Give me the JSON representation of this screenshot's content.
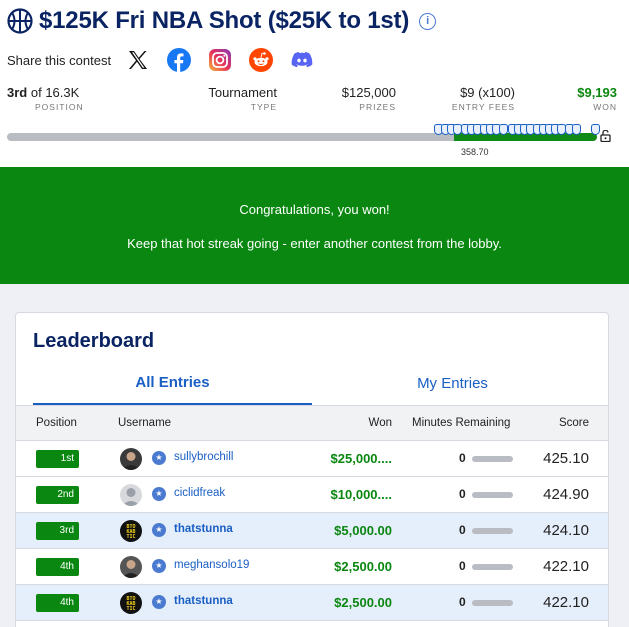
{
  "contest": {
    "title": "$125K Fri NBA Shot ($25K to 1st)",
    "share_label": "Share this contest",
    "socials": [
      "x-icon",
      "facebook-icon",
      "instagram-icon",
      "reddit-icon",
      "discord-icon"
    ]
  },
  "stats": {
    "rank_place": "3rd",
    "rank_of": "of 16.3K",
    "position_label": "POSITION",
    "type_value": "Tournament",
    "type_label": "TYPE",
    "prizes_value": "$125,000",
    "prizes_label": "PRIZES",
    "fees_value": "$9 (x100)",
    "fees_label": "ENTRY FEES",
    "won_value": "$9,193",
    "won_label": "WON"
  },
  "progress": {
    "value_label": "358.70"
  },
  "banner": {
    "line1": "Congratulations, you won!",
    "line2": "Keep that hot streak going - enter another contest from the lobby."
  },
  "leaderboard": {
    "title": "Leaderboard",
    "tabs": [
      "All Entries",
      "My Entries"
    ],
    "columns": {
      "position": "Position",
      "username": "Username",
      "won": "Won",
      "minutes": "Minutes Remaining",
      "score": "Score"
    },
    "rows": [
      {
        "pos": "1st",
        "user": "sullybrochill",
        "won": "$25,000....",
        "mins": "0",
        "score": "425.10",
        "mine": false
      },
      {
        "pos": "2nd",
        "user": "ciclidfreak",
        "won": "$10,000....",
        "mins": "0",
        "score": "424.90",
        "mine": false
      },
      {
        "pos": "3rd",
        "user": "thatstunna",
        "won": "$5,000.00",
        "mins": "0",
        "score": "424.10",
        "mine": true
      },
      {
        "pos": "4th",
        "user": "meghansolo19",
        "won": "$2,500.00",
        "mins": "0",
        "score": "422.10",
        "mine": false
      },
      {
        "pos": "4th",
        "user": "thatstunna",
        "won": "$2,500.00",
        "mins": "0",
        "score": "422.10",
        "mine": true
      }
    ]
  },
  "colors": {
    "brand_navy": "#0a2463",
    "link_blue": "#1a5fc4",
    "win_green": "#0a8710",
    "highlight_row": "#e5eefb"
  }
}
